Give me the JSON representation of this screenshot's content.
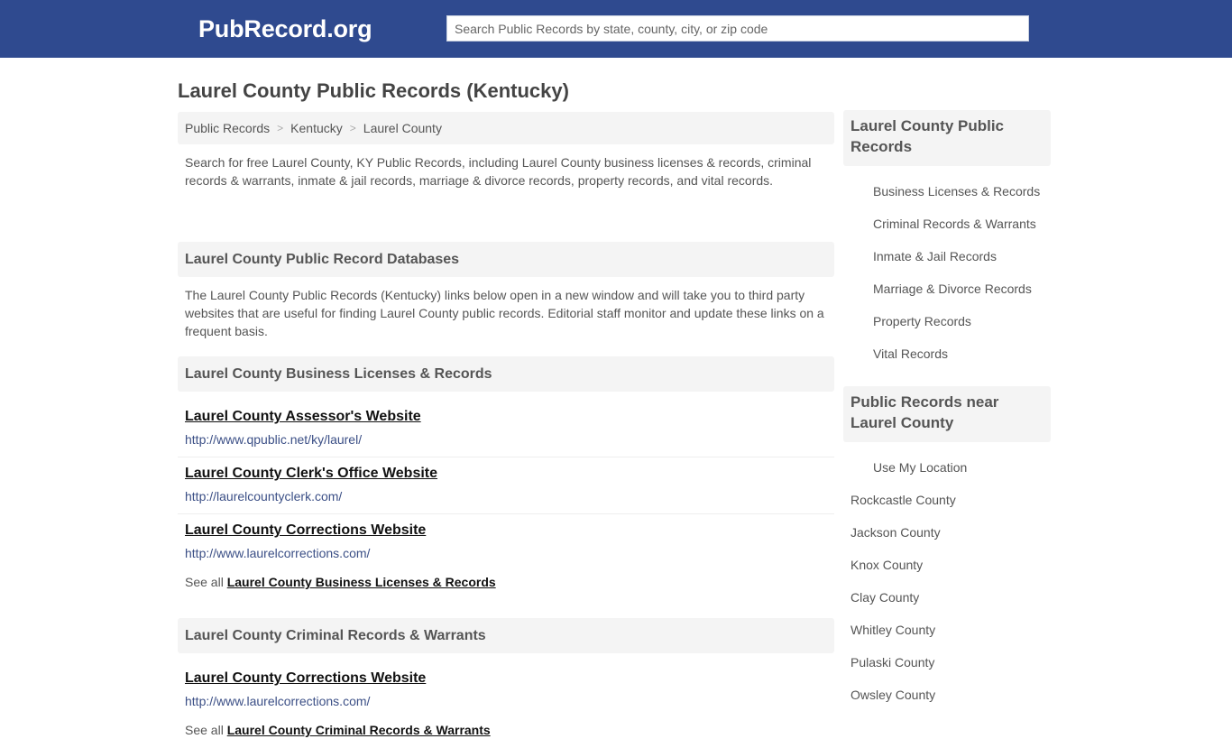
{
  "header": {
    "logo": "PubRecord.org",
    "search_placeholder": "Search Public Records by state, county, city, or zip code"
  },
  "page_title": "Laurel County Public Records (Kentucky)",
  "breadcrumb": [
    {
      "label": "Public Records"
    },
    {
      "label": "Kentucky"
    },
    {
      "label": "Laurel County"
    }
  ],
  "breadcrumb_separator": ">",
  "intro": "Search for free Laurel County, KY Public Records, including Laurel County business licenses & records, criminal records & warrants, inmate & jail records, marriage & divorce records, property records, and vital records.",
  "databases": {
    "heading": "Laurel County Public Record Databases",
    "description": "The Laurel County Public Records (Kentucky) links below open in a new window and will take you to third party websites that are useful for finding Laurel County public records. Editorial staff monitor and update these links on a frequent basis."
  },
  "sections": [
    {
      "heading": "Laurel County Business Licenses & Records",
      "links": [
        {
          "title": "Laurel County Assessor's Website",
          "url": "http://www.qpublic.net/ky/laurel/"
        },
        {
          "title": "Laurel County Clerk's Office Website",
          "url": "http://laurelcountyclerk.com/"
        },
        {
          "title": "Laurel County Corrections Website",
          "url": "http://www.laurelcorrections.com/"
        }
      ],
      "see_all_prefix": "See all",
      "see_all_label": "Laurel County Business Licenses & Records"
    },
    {
      "heading": "Laurel County Criminal Records & Warrants",
      "links": [
        {
          "title": "Laurel County Corrections Website",
          "url": "http://www.laurelcorrections.com/"
        }
      ],
      "see_all_prefix": "See all",
      "see_all_label": "Laurel County Criminal Records & Warrants"
    }
  ],
  "sidebar": {
    "records_heading": "Laurel County Public Records",
    "records_links": [
      "Business Licenses & Records",
      "Criminal Records & Warrants",
      "Inmate & Jail Records",
      "Marriage & Divorce Records",
      "Property Records",
      "Vital Records"
    ],
    "nearby_heading": "Public Records near Laurel County",
    "use_location": "Use My Location",
    "nearby_counties": [
      "Rockcastle County",
      "Jackson County",
      "Knox County",
      "Clay County",
      "Whitley County",
      "Pulaski County",
      "Owsley County"
    ]
  },
  "colors": {
    "brand_header": "#2f4a8f",
    "panel_bg": "#f4f4f4",
    "url_color": "#3b4f86"
  }
}
